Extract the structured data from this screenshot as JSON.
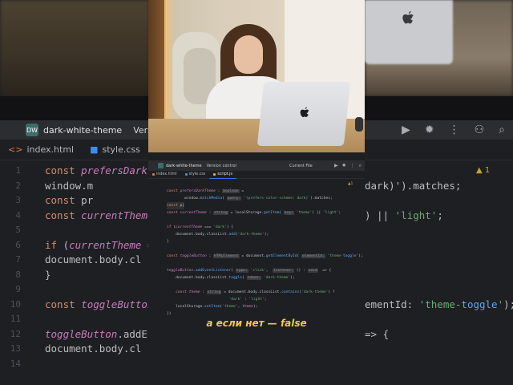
{
  "ide": {
    "project_badge": "DW",
    "project_name": "dark-white-theme",
    "vcs_label": "Version control",
    "current_file_label": "Current File",
    "tabs": [
      {
        "label": "index.html",
        "color": "#e0773a",
        "active": false
      },
      {
        "label": "style.css",
        "color": "#3b8eea",
        "active": false
      },
      {
        "label": "script.js",
        "color": "#d9b541",
        "active": true
      }
    ],
    "warning_count": "1",
    "code_lines": [
      "const prefersDarkTheme : boolean =",
      "        window.matchMedia( query: '(prefers-color-scheme: dark)').matches;",
      "const p|",
      "const currentTheme : string = localStorage.getItem( key: 'theme') || 'light';",
      "",
      "if (currentTheme === 'dark') {",
      "    document.body.classList.add('dark-theme');",
      "}",
      "",
      "const toggleButton : HTMLElement = document.getElementById( elementId: 'theme-toggle');",
      "",
      "toggleButton.addEventListener( type: 'click',  listener: () : void  => {",
      "    document.body.classList.toggle( token: 'dark-theme');",
      "",
      "    const theme : string = document.body.classList.contains('dark-theme') ?",
      "                            'dark' : 'light';",
      "    localStorage.setItem('theme', theme);",
      "})"
    ]
  },
  "background": {
    "tabs": [
      {
        "label": "index.html",
        "color": "#e0773a"
      },
      {
        "label": "style.css",
        "color": "#3b8eea"
      }
    ],
    "line_numbers": [
      "1",
      "2",
      "3",
      "4",
      "5",
      "6",
      "7",
      "8",
      "9",
      "10",
      "11",
      "12",
      "13",
      "14"
    ],
    "code_lines": [
      "const prefersDarkTheme",
      "        window.m",
      "const pr",
      "const currentTheme :",
      "",
      "if (currentTheme ===",
      "    document.body.cl",
      "}",
      "",
      "const toggleButton :",
      "",
      "toggleButton.addEven",
      "    document.body.cl"
    ],
    "right_fragments": [
      {
        "text": "dark)').matches;",
        "line": 1
      },
      {
        "text": ") || 'light';",
        "line": 3
      },
      {
        "text": "ementId: 'theme-toggle');",
        "line": 9
      },
      {
        "text": "=> {",
        "line": 11
      }
    ],
    "warning_count": "1"
  },
  "subtitle": "а если нет — false"
}
